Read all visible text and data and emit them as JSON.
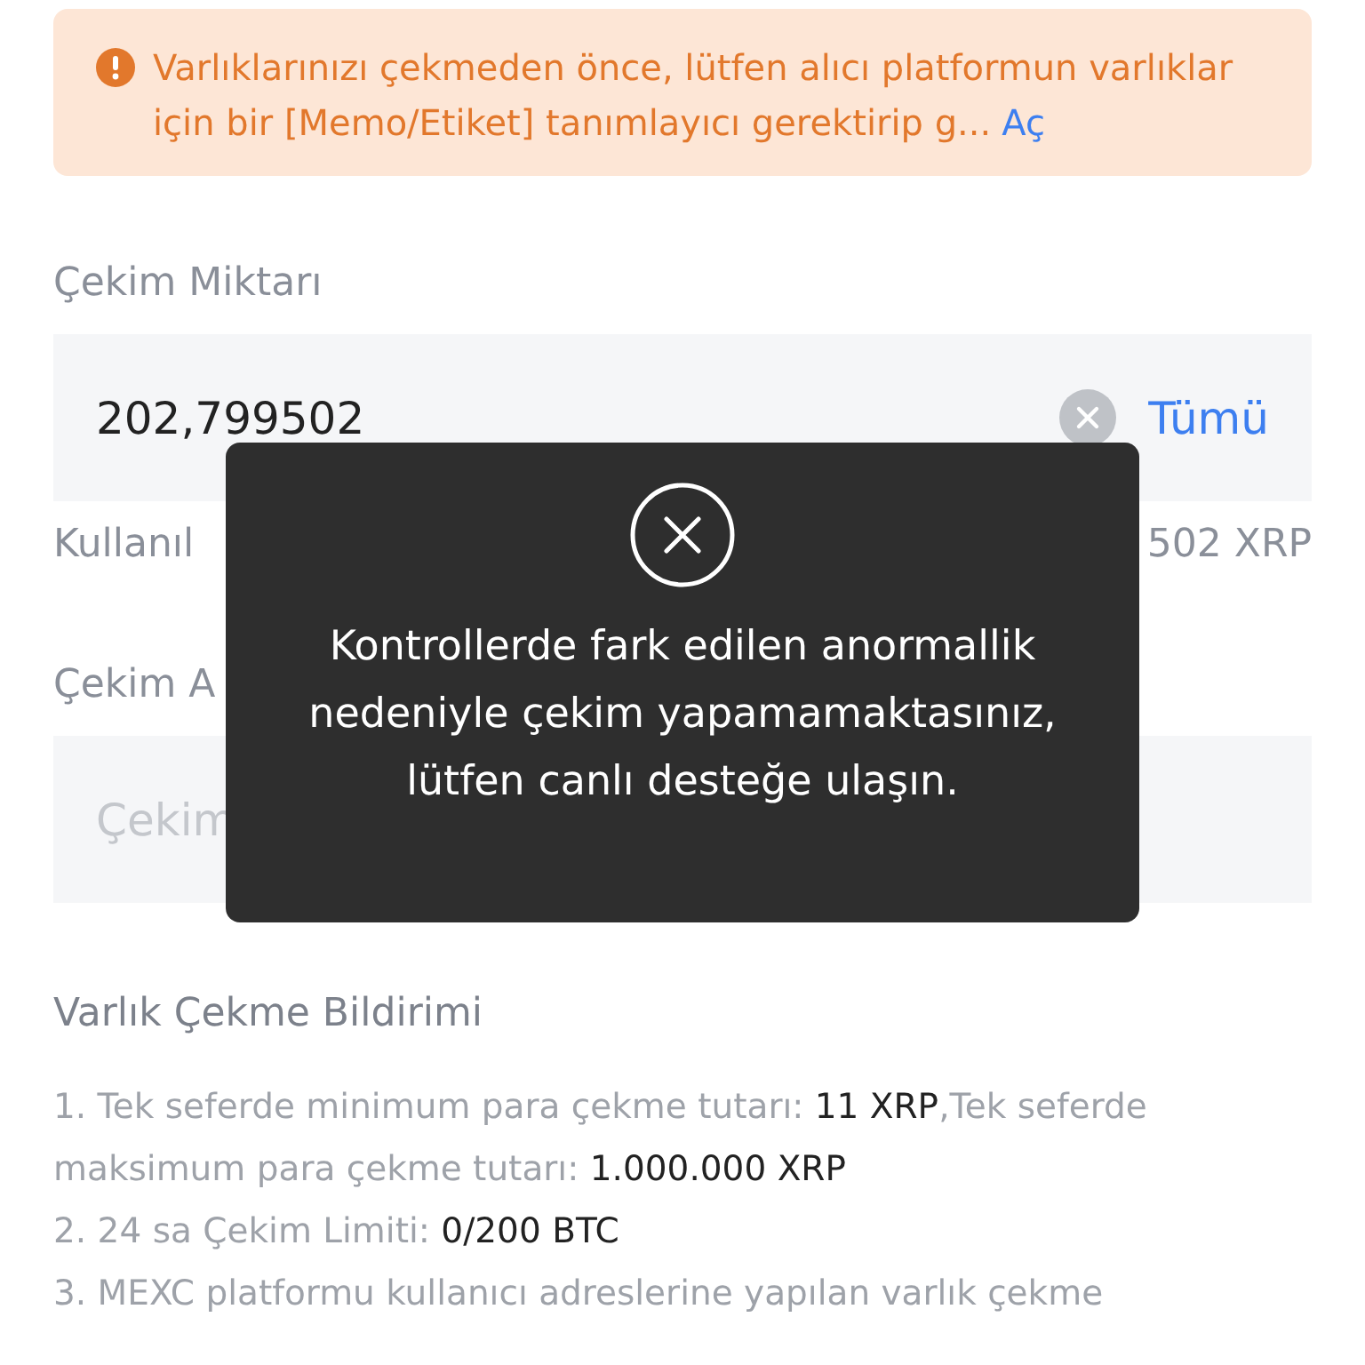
{
  "warning": {
    "text": "Varlıklarınızı çekmeden önce, lütfen alıcı platformun varlıklar için bir [Memo/Etiket] tanımlayıcı gerektirip g...",
    "link": "Aç"
  },
  "amount": {
    "label": "Çekim Miktarı",
    "value": "202,799502",
    "max_button": "Tümü"
  },
  "available": {
    "label": "Kullanıl",
    "value": "502 XRP"
  },
  "remark": {
    "label": "Çekim A",
    "placeholder": "Çekim"
  },
  "notice": {
    "title": "Varlık Çekme Bildirimi",
    "items": [
      [
        {
          "text": "1. Tek seferde minimum para çekme tutarı: ",
          "emphasis": false
        },
        {
          "text": "11 XRP",
          "emphasis": true
        },
        {
          "text": ",Tek seferde maksimum para çekme tutarı: ",
          "emphasis": false
        },
        {
          "text": "1.000.000 XRP",
          "emphasis": true
        }
      ],
      [
        {
          "text": "2. 24 sa Çekim Limiti: ",
          "emphasis": false
        },
        {
          "text": "0/200 BTC",
          "emphasis": true
        }
      ],
      [
        {
          "text": "3. MEXC platformu kullanıcı adreslerine yapılan varlık çekme",
          "emphasis": false
        }
      ]
    ]
  },
  "toast": {
    "message": "Kontrollerde fark edilen anormallik nedeniyle çekim yapamamaktasınız, lütfen canlı desteğe ulaşın."
  }
}
